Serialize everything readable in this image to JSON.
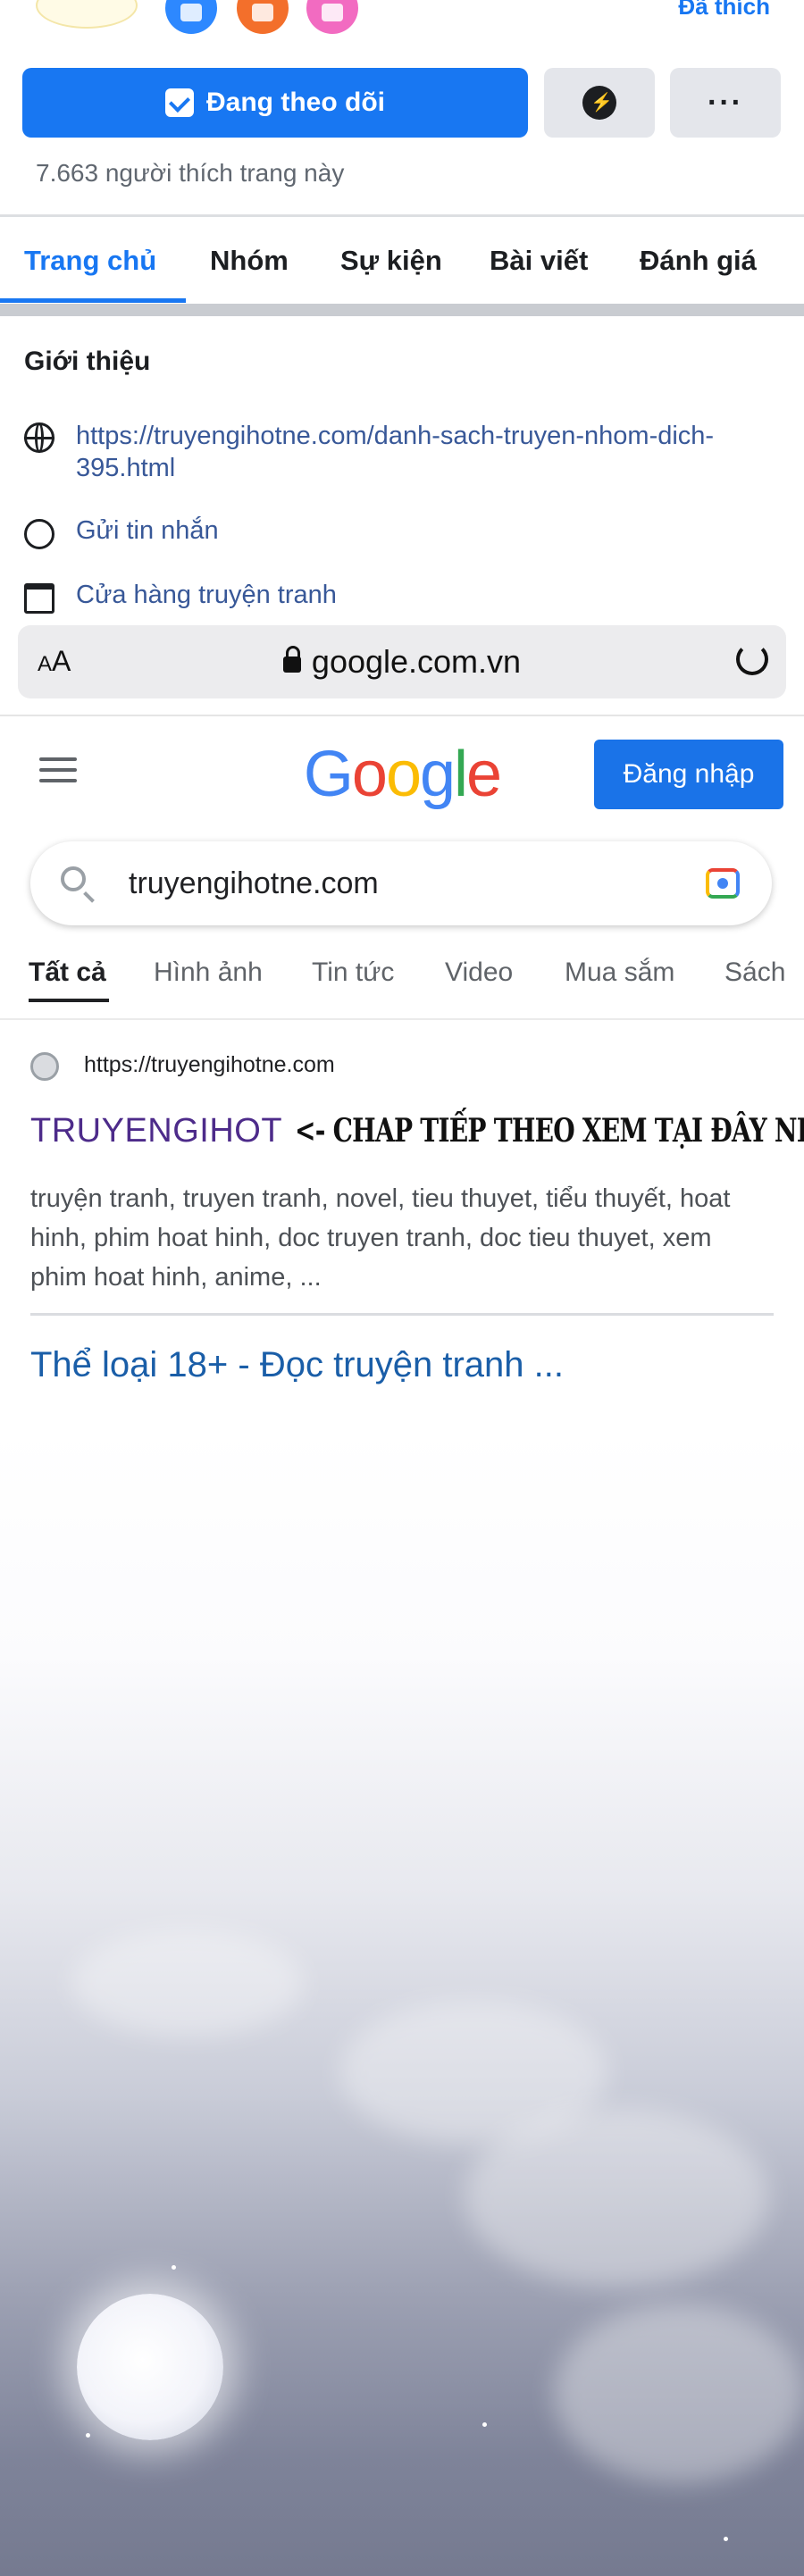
{
  "facebook": {
    "liked_label": "Đã thích",
    "follow_button": "Đang theo dõi",
    "likes_count": "7.663 người thích trang này",
    "tabs": [
      "Trang chủ",
      "Nhóm",
      "Sự kiện",
      "Bài viết",
      "Đánh giá"
    ],
    "intro_title": "Giới thiệu",
    "intro_items": [
      {
        "icon": "globe-icon",
        "text": "https://truyengihotne.com/danh-sach-truyen-nhom-dich-395.html"
      },
      {
        "icon": "messenger-icon",
        "text": "Gửi tin nhắn"
      },
      {
        "icon": "shop-icon",
        "text": "Cửa hàng truyện tranh"
      }
    ]
  },
  "browser": {
    "text_size_label": "AA",
    "address": "google.com.vn"
  },
  "google": {
    "sign_in": "Đăng nhập",
    "search_query": "truyengihotne.com",
    "tabs": [
      "Tất cả",
      "Hình ảnh",
      "Tin tức",
      "Video",
      "Mua sắm",
      "Sách"
    ],
    "result1": {
      "url": "https://truyengihotne.com",
      "title": "TRUYENGIHOT",
      "overlay_text": "<- CHAP TIẾP THEO XEM TẠI ĐÂY NHA",
      "description": "truyện tranh, truyen tranh, novel, tieu thuyet, tiểu thuyết, hoat hinh, phim hoat hinh, doc truyen tranh, doc tieu thuyet, xem phim hoat hinh, anime, ..."
    },
    "result2": {
      "title": "Thể loại 18+ - Đọc truyện tranh ..."
    }
  },
  "colors": {
    "facebook_blue": "#1877f2",
    "google_signin": "#1a73e8",
    "link_purple": "#4d2b8a",
    "link_blue": "#1a5ea8"
  }
}
